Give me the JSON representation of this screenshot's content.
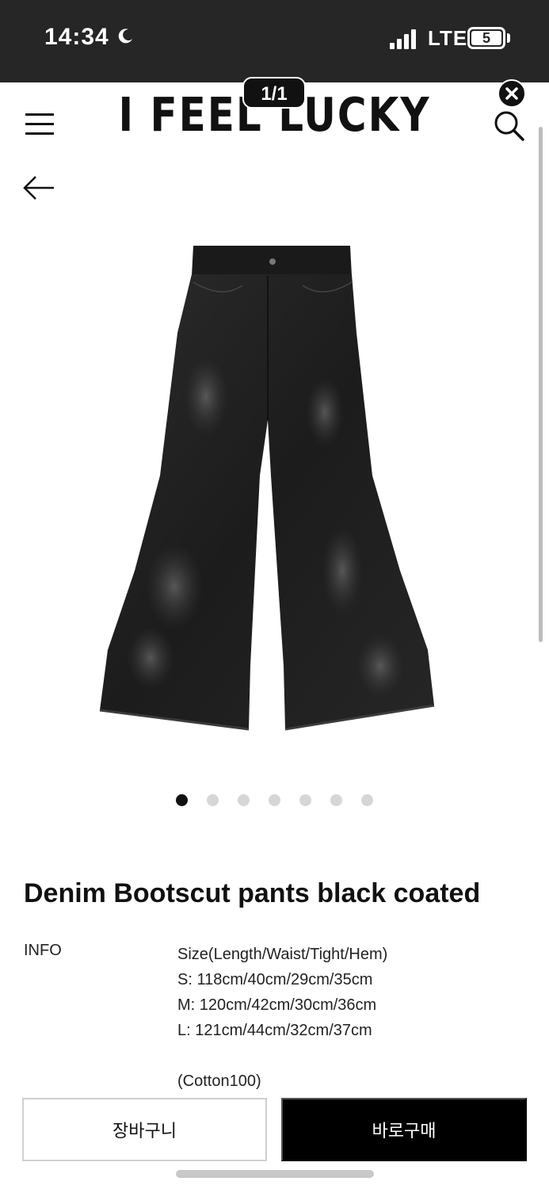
{
  "status_bar": {
    "time": "14:34",
    "network": "LTE",
    "battery": "5",
    "icons": [
      "moon-icon",
      "signal-icon",
      "battery-icon"
    ]
  },
  "header": {
    "brand": "I FEEL LUCKY",
    "image_counter": "1/1",
    "icons": [
      "menu-icon",
      "search-icon",
      "close-icon",
      "back-arrow-icon"
    ]
  },
  "gallery": {
    "total_images": 7,
    "active_index": 0
  },
  "product": {
    "title": "Denim Bootscut pants black coated",
    "info_label": "INFO",
    "info_lines": [
      "Size(Length/Waist/Tight/Hem)",
      "S: 118cm/40cm/29cm/35cm",
      "M: 120cm/42cm/30cm/36cm",
      "L: 121cm/44cm/32cm/37cm"
    ],
    "material": "(Cotton100)"
  },
  "actions": {
    "cart_label": "장바구니",
    "buy_label": "바로구매"
  },
  "colors": {
    "status_bar_bg": "#262626",
    "primary": "#000000",
    "dot_inactive": "#d6d6d6"
  }
}
